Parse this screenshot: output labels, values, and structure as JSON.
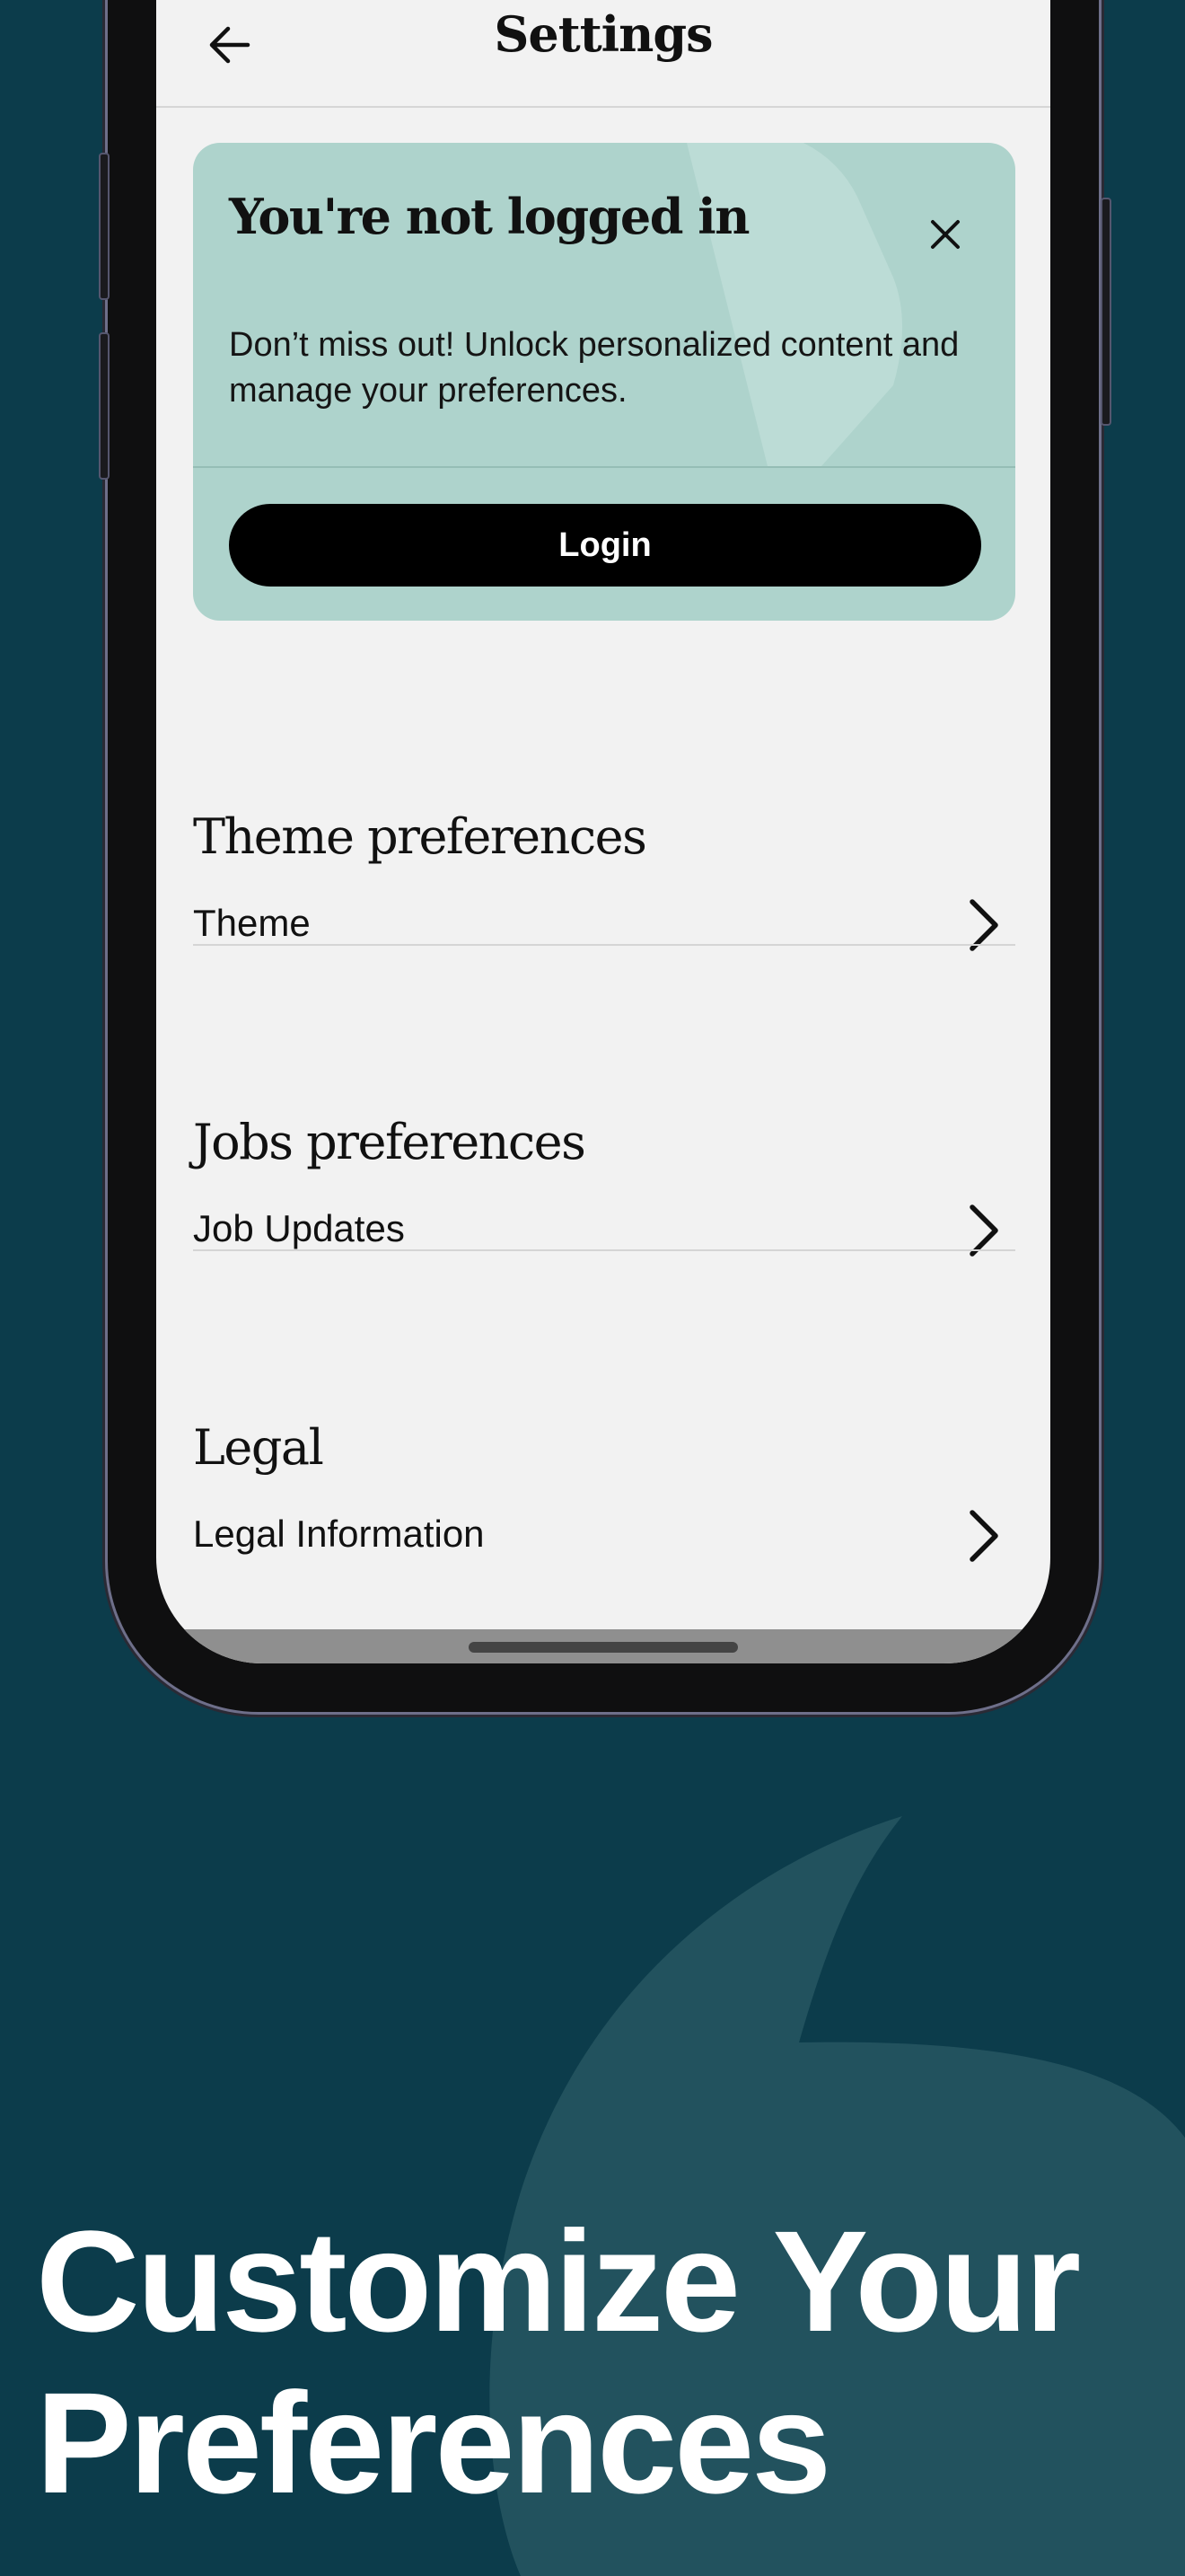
{
  "colors": {
    "background": "#0c3c4b",
    "screen": "#f2f2f2",
    "card": "#aed3cc",
    "button": "#000000",
    "headline": "#ffffff"
  },
  "navbar": {
    "title": "Settings",
    "back_icon": "arrow-left-icon"
  },
  "login_card": {
    "title": "You're not logged in",
    "message": "Don’t miss out! Unlock personalized content and manage your preferences.",
    "button_label": "Login",
    "close_icon": "close-icon"
  },
  "sections": [
    {
      "heading": "Theme preferences",
      "item": "Theme",
      "icon": "chevron-right-icon"
    },
    {
      "heading": "Jobs preferences",
      "item": "Job Updates",
      "icon": "chevron-right-icon"
    },
    {
      "heading": "Legal",
      "item": "Legal Information",
      "icon": "chevron-right-icon"
    }
  ],
  "headline": {
    "line1": "Customize Your",
    "line2": "Preferences"
  }
}
